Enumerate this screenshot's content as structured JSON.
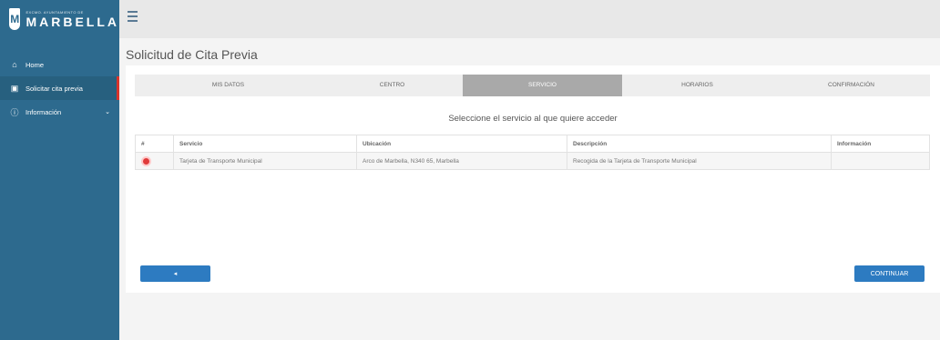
{
  "logo": {
    "sub": "EXCMO. AYUNTAMIENTO DE",
    "main": "MARBELLA",
    "shield_glyph": "M"
  },
  "sidebar": {
    "items": [
      {
        "label": "Home",
        "icon": "home-icon",
        "glyph": "⌂"
      },
      {
        "label": "Solicitar cita previa",
        "icon": "calendar-icon",
        "glyph": "▣"
      },
      {
        "label": "Información",
        "icon": "info-icon",
        "glyph": "ⓘ"
      }
    ],
    "chevron_glyph": "⌄"
  },
  "page": {
    "title": "Solicitud de Cita Previa"
  },
  "steps": [
    "MIS DATOS",
    "CENTRO",
    "SERVICIO",
    "HORARIOS",
    "CONFIRMACIÓN"
  ],
  "instruction": "Seleccione el servicio al que quiere acceder",
  "table": {
    "headers": [
      "#",
      "Servicio",
      "Ubicación",
      "Descripción",
      "Información"
    ],
    "rows": [
      [
        "",
        "Tarjeta de Transporte Municipal",
        "Arco de Marbella, N340 65, Marbella",
        "Recogida de la Tarjeta de Transporte Municipal",
        ""
      ]
    ]
  },
  "buttons": {
    "back_glyph": "◂",
    "next": "CONTINUAR"
  },
  "colors": {
    "sidebar": "#2d6a8e",
    "accent_button": "#2d7bc1",
    "active_step": "#a9a9a9",
    "active_nav_marker": "#d9342b",
    "radio": "#e03a3a"
  }
}
